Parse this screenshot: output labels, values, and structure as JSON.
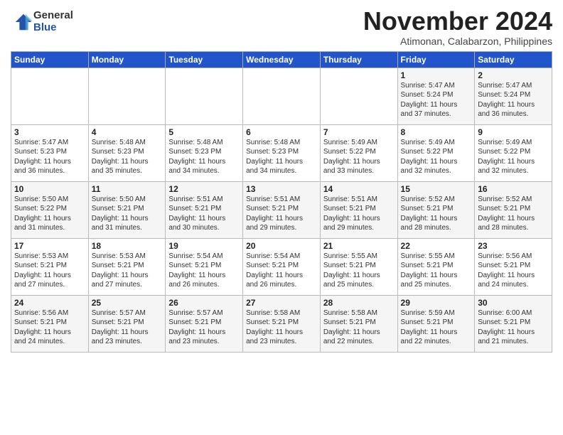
{
  "logo": {
    "general": "General",
    "blue": "Blue"
  },
  "header": {
    "month": "November 2024",
    "location": "Atimonan, Calabarzon, Philippines"
  },
  "weekdays": [
    "Sunday",
    "Monday",
    "Tuesday",
    "Wednesday",
    "Thursday",
    "Friday",
    "Saturday"
  ],
  "weeks": [
    [
      {
        "day": "",
        "info": ""
      },
      {
        "day": "",
        "info": ""
      },
      {
        "day": "",
        "info": ""
      },
      {
        "day": "",
        "info": ""
      },
      {
        "day": "",
        "info": ""
      },
      {
        "day": "1",
        "info": "Sunrise: 5:47 AM\nSunset: 5:24 PM\nDaylight: 11 hours\nand 37 minutes."
      },
      {
        "day": "2",
        "info": "Sunrise: 5:47 AM\nSunset: 5:24 PM\nDaylight: 11 hours\nand 36 minutes."
      }
    ],
    [
      {
        "day": "3",
        "info": "Sunrise: 5:47 AM\nSunset: 5:23 PM\nDaylight: 11 hours\nand 36 minutes."
      },
      {
        "day": "4",
        "info": "Sunrise: 5:48 AM\nSunset: 5:23 PM\nDaylight: 11 hours\nand 35 minutes."
      },
      {
        "day": "5",
        "info": "Sunrise: 5:48 AM\nSunset: 5:23 PM\nDaylight: 11 hours\nand 34 minutes."
      },
      {
        "day": "6",
        "info": "Sunrise: 5:48 AM\nSunset: 5:23 PM\nDaylight: 11 hours\nand 34 minutes."
      },
      {
        "day": "7",
        "info": "Sunrise: 5:49 AM\nSunset: 5:22 PM\nDaylight: 11 hours\nand 33 minutes."
      },
      {
        "day": "8",
        "info": "Sunrise: 5:49 AM\nSunset: 5:22 PM\nDaylight: 11 hours\nand 32 minutes."
      },
      {
        "day": "9",
        "info": "Sunrise: 5:49 AM\nSunset: 5:22 PM\nDaylight: 11 hours\nand 32 minutes."
      }
    ],
    [
      {
        "day": "10",
        "info": "Sunrise: 5:50 AM\nSunset: 5:22 PM\nDaylight: 11 hours\nand 31 minutes."
      },
      {
        "day": "11",
        "info": "Sunrise: 5:50 AM\nSunset: 5:21 PM\nDaylight: 11 hours\nand 31 minutes."
      },
      {
        "day": "12",
        "info": "Sunrise: 5:51 AM\nSunset: 5:21 PM\nDaylight: 11 hours\nand 30 minutes."
      },
      {
        "day": "13",
        "info": "Sunrise: 5:51 AM\nSunset: 5:21 PM\nDaylight: 11 hours\nand 29 minutes."
      },
      {
        "day": "14",
        "info": "Sunrise: 5:51 AM\nSunset: 5:21 PM\nDaylight: 11 hours\nand 29 minutes."
      },
      {
        "day": "15",
        "info": "Sunrise: 5:52 AM\nSunset: 5:21 PM\nDaylight: 11 hours\nand 28 minutes."
      },
      {
        "day": "16",
        "info": "Sunrise: 5:52 AM\nSunset: 5:21 PM\nDaylight: 11 hours\nand 28 minutes."
      }
    ],
    [
      {
        "day": "17",
        "info": "Sunrise: 5:53 AM\nSunset: 5:21 PM\nDaylight: 11 hours\nand 27 minutes."
      },
      {
        "day": "18",
        "info": "Sunrise: 5:53 AM\nSunset: 5:21 PM\nDaylight: 11 hours\nand 27 minutes."
      },
      {
        "day": "19",
        "info": "Sunrise: 5:54 AM\nSunset: 5:21 PM\nDaylight: 11 hours\nand 26 minutes."
      },
      {
        "day": "20",
        "info": "Sunrise: 5:54 AM\nSunset: 5:21 PM\nDaylight: 11 hours\nand 26 minutes."
      },
      {
        "day": "21",
        "info": "Sunrise: 5:55 AM\nSunset: 5:21 PM\nDaylight: 11 hours\nand 25 minutes."
      },
      {
        "day": "22",
        "info": "Sunrise: 5:55 AM\nSunset: 5:21 PM\nDaylight: 11 hours\nand 25 minutes."
      },
      {
        "day": "23",
        "info": "Sunrise: 5:56 AM\nSunset: 5:21 PM\nDaylight: 11 hours\nand 24 minutes."
      }
    ],
    [
      {
        "day": "24",
        "info": "Sunrise: 5:56 AM\nSunset: 5:21 PM\nDaylight: 11 hours\nand 24 minutes."
      },
      {
        "day": "25",
        "info": "Sunrise: 5:57 AM\nSunset: 5:21 PM\nDaylight: 11 hours\nand 23 minutes."
      },
      {
        "day": "26",
        "info": "Sunrise: 5:57 AM\nSunset: 5:21 PM\nDaylight: 11 hours\nand 23 minutes."
      },
      {
        "day": "27",
        "info": "Sunrise: 5:58 AM\nSunset: 5:21 PM\nDaylight: 11 hours\nand 23 minutes."
      },
      {
        "day": "28",
        "info": "Sunrise: 5:58 AM\nSunset: 5:21 PM\nDaylight: 11 hours\nand 22 minutes."
      },
      {
        "day": "29",
        "info": "Sunrise: 5:59 AM\nSunset: 5:21 PM\nDaylight: 11 hours\nand 22 minutes."
      },
      {
        "day": "30",
        "info": "Sunrise: 6:00 AM\nSunset: 5:21 PM\nDaylight: 11 hours\nand 21 minutes."
      }
    ]
  ]
}
